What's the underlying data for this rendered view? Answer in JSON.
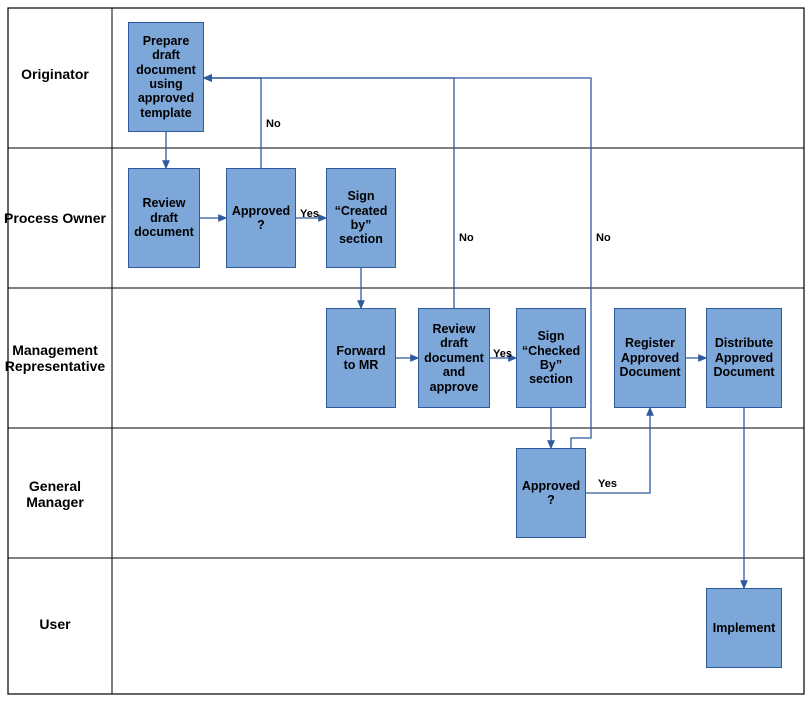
{
  "lanes": {
    "originator": "Originator",
    "processOwner": "Process Owner",
    "mgmtRep": "Management\nRepresentative",
    "gm": "General\nManager",
    "user": "User"
  },
  "nodes": {
    "prepare": "Prepare draft document using approved template",
    "review1": "Review draft document",
    "approved1": "Approved ?",
    "signCreated": "Sign “Created by” section",
    "forward": "Forward to MR",
    "review2": "Review draft document and approve",
    "signChecked": "Sign “Checked By” section",
    "register": "Register Approved Document",
    "distribute": "Distribute Approved Document",
    "approved2": "Approved ?",
    "implement": "Implement"
  },
  "edges": {
    "yes1": "Yes",
    "no1": "No",
    "yes2": "Yes",
    "no2": "No",
    "yes3": "Yes",
    "no3": "No"
  }
}
